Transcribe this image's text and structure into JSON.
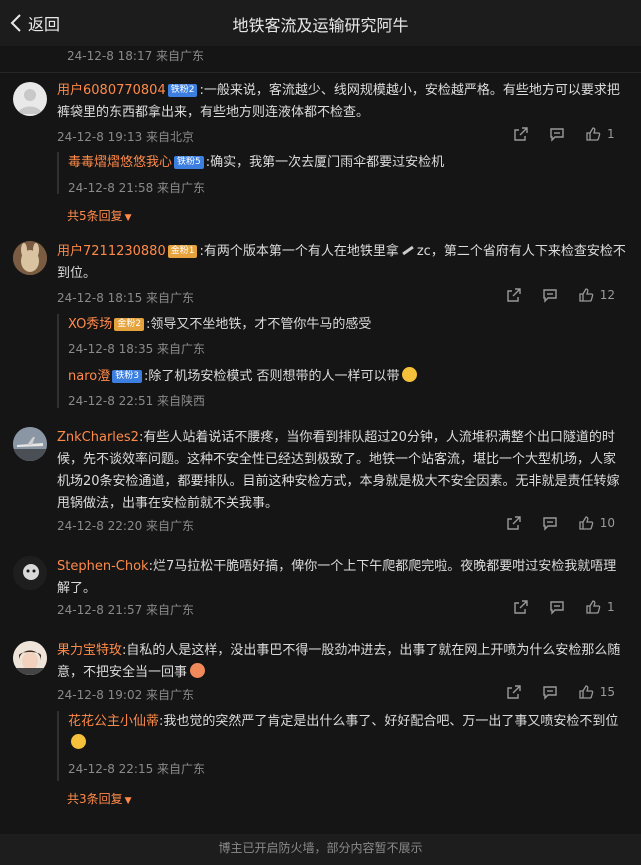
{
  "header": {
    "back_label": "返回",
    "title": "地铁客流及运输研究阿牛"
  },
  "top_meta": "24-12-8 18:17 来自广东",
  "comments": [
    {
      "user": "用户6080770804",
      "badge": "铁粉2",
      "text": ":一般来说，客流越少、线网规模越小，安检越严格。有些地方可以要求把裤袋里的东西都拿出来，有些地方则连液体都不检查。",
      "meta": "24-12-8 19:13 来自北京",
      "likes": "1",
      "replies": [
        {
          "user": "毒毒熠熠悠悠我心",
          "badge": "铁粉5",
          "text": ":确实，我第一次去厦门雨伞都要过安检机",
          "meta": "24-12-8 21:58 来自广东"
        }
      ],
      "more": "共5条回复"
    },
    {
      "user": "用户7211230880",
      "badge": "金粉1",
      "text_a": ":有两个版本第一个有人在地铁里拿",
      "text_b": "zc，第二个省府有人下来检查安检不到位。",
      "meta": "24-12-8 18:15 来自广东",
      "likes": "12",
      "replies": [
        {
          "user": "XO秀场",
          "badge": "金粉2",
          "text": ":领导又不坐地铁，才不管你牛马的感受",
          "meta": "24-12-8 18:35 来自广东"
        },
        {
          "user": "naro澄",
          "badge": "铁粉3",
          "text": ":除了机场安检模式 否则想带的人一样可以带",
          "meta": "24-12-8 22:51 来自陕西"
        }
      ]
    },
    {
      "user": "ZnkCharles2",
      "text": ":有些人站着说话不腰疼，当你看到排队超过20分钟，人流堆积满整个出口隧道的时候，先不谈效率问题。这种不安全性已经达到极致了。地铁一个站客流，堪比一个大型机场，人家机场20条安检通道，都要排队。目前这种安检方式，本身就是极大不安全因素。无非就是责任转嫁甩锅做法，出事在安检前就不关我事。",
      "meta": "24-12-8 22:20 来自广东",
      "likes": "10"
    },
    {
      "user": "Stephen-Chok",
      "text": ":烂7马拉松干脆唔好搞，俾你一个上下午爬都爬完啦。夜晚都要咁过安检我就唔理解了。",
      "meta": "24-12-8 21:57 来自广东",
      "likes": "1"
    },
    {
      "user": "果力宝特玫",
      "text": ":自私的人是这样，没出事巴不得一股劲冲进去，出事了就在网上开喷为什么安检那么随意，不把安全当一回事",
      "meta": "24-12-8 19:02 来自广东",
      "likes": "15",
      "replies": [
        {
          "user": "花花公主小仙蒂",
          "text": ":我也觉的突然严了肯定是出什么事了、好好配合吧、万一出了事又喷安检不到位",
          "meta": "24-12-8 22:15 来自广东"
        }
      ],
      "more": "共3条回复"
    }
  ],
  "footer": "博主已开启防火墙，部分内容暂不展示",
  "icons": {
    "share": "share-icon",
    "comment": "comment-icon",
    "like": "thumbs-up-icon",
    "back": "chevron-left-icon"
  },
  "colors": {
    "username": "#ff8a4a",
    "background": "#151515"
  }
}
